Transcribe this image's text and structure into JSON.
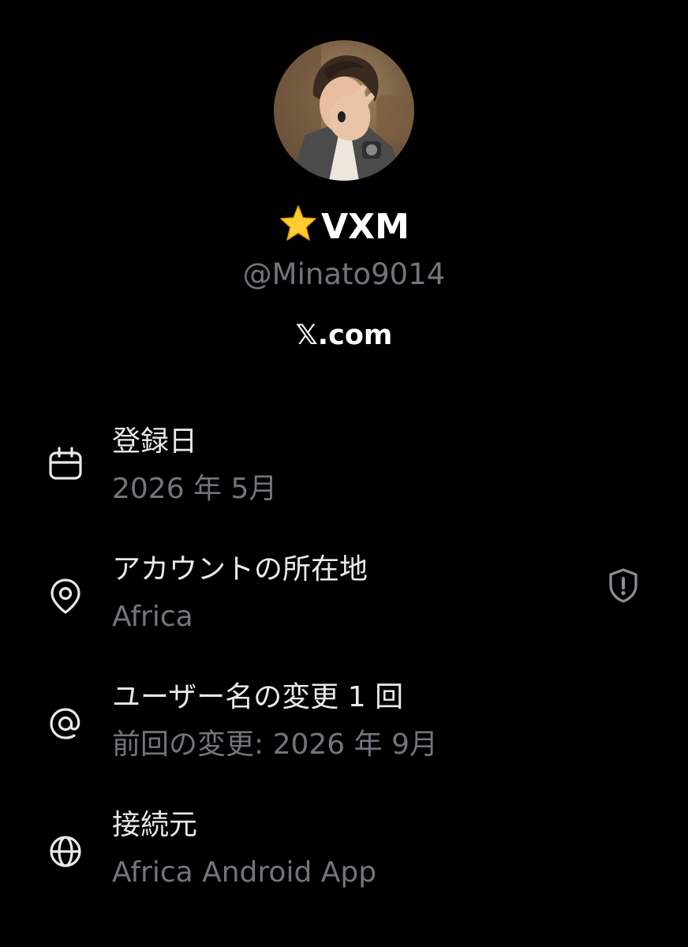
{
  "profile": {
    "display_name": "VXM",
    "handle": "@Minato9014",
    "site": "𝕏.com",
    "avatar_icon": "avatar-portrait",
    "name_badge_icon": "star-emoji"
  },
  "about": {
    "joined": {
      "icon": "calendar-icon",
      "title": "登録日",
      "value": "2026 年 5月"
    },
    "location": {
      "icon": "location-pin-icon",
      "title": "アカウントの所在地",
      "value": "Africa",
      "badge_icon": "shield-alert-icon"
    },
    "username_changes": {
      "icon": "at-sign-icon",
      "title": "ユーザー名の変更 1 回",
      "value": "前回の変更: 2026 年 9月"
    },
    "connected_via": {
      "icon": "globe-icon",
      "title": "接続元",
      "value": "Africa Android App"
    }
  },
  "colors": {
    "background": "#000000",
    "primary_text": "#e7e9ea",
    "secondary_text": "#71767b",
    "star": "#ffcc33"
  }
}
